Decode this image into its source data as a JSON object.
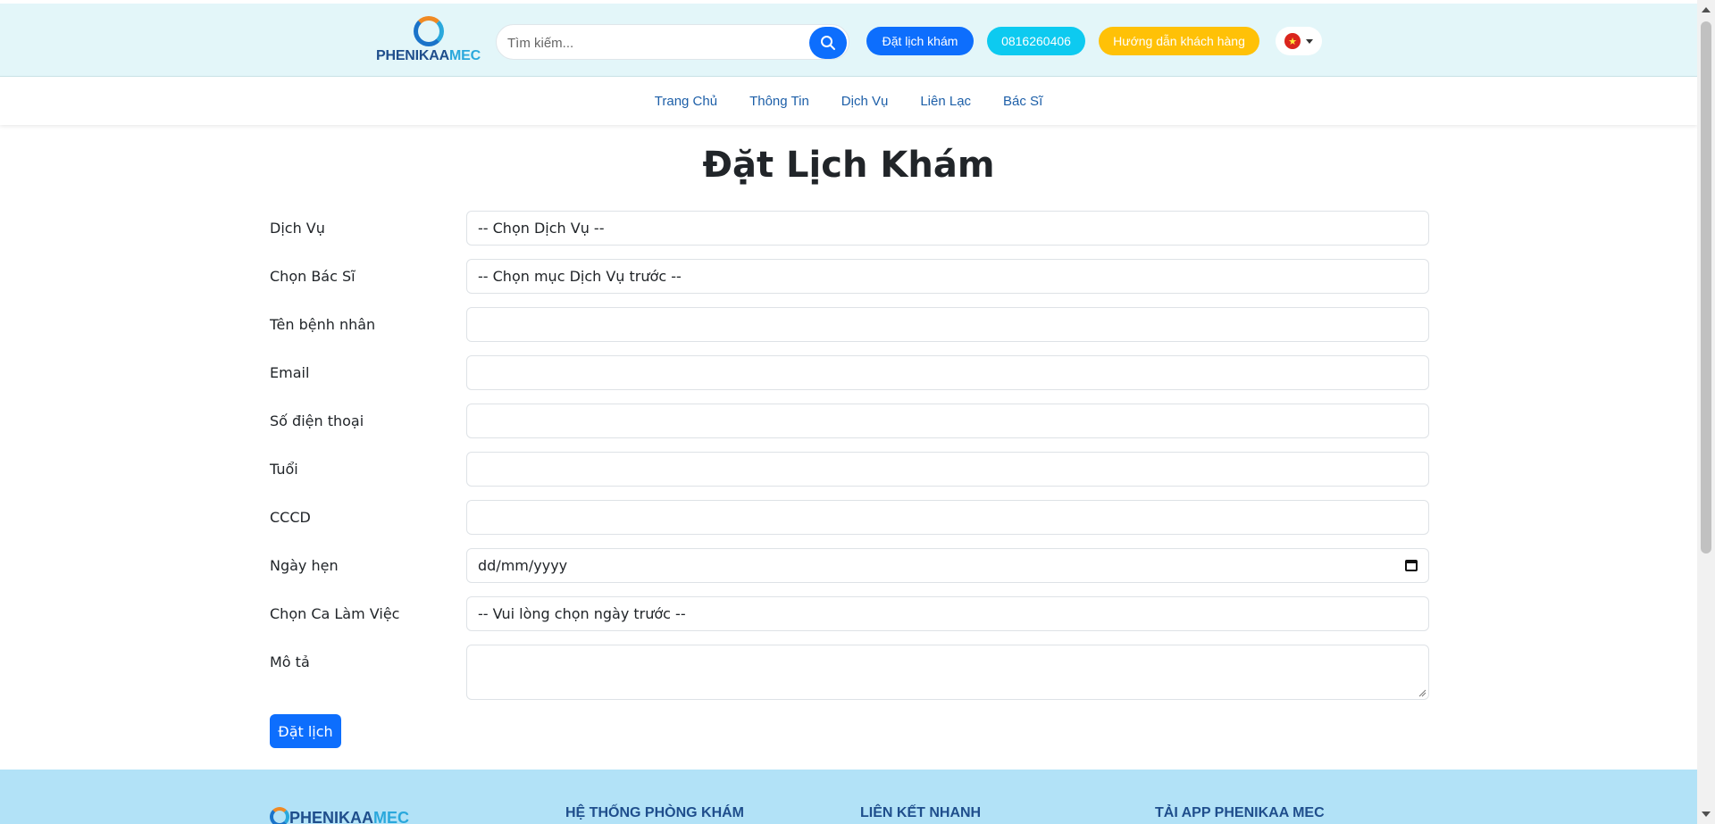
{
  "header": {
    "logo": {
      "part1": "PHENIKAA",
      "part2": "MEC"
    },
    "search": {
      "placeholder": "Tìm kiếm..."
    },
    "book_button": "Đặt lịch khám",
    "phone_button": "0816260406",
    "guide_button": "Hướng dẫn khách hàng",
    "language": {
      "icon": "vietnam-flag-icon"
    }
  },
  "nav": {
    "items": [
      "Trang Chủ",
      "Thông Tin",
      "Dịch Vụ",
      "Liên Lạc",
      "Bác Sĩ"
    ]
  },
  "main": {
    "title": "Đặt Lịch Khám",
    "fields": {
      "service": {
        "label": "Dịch Vụ",
        "value": "-- Chọn Dịch Vụ --"
      },
      "doctor": {
        "label": "Chọn Bác Sĩ",
        "value": "-- Chọn mục Dịch Vụ trước --"
      },
      "patient_name": {
        "label": "Tên bệnh nhân",
        "value": ""
      },
      "email": {
        "label": "Email",
        "value": ""
      },
      "phone": {
        "label": "Số điện thoại",
        "value": ""
      },
      "age": {
        "label": "Tuổi",
        "value": ""
      },
      "cccd": {
        "label": "CCCD",
        "value": ""
      },
      "date": {
        "label": "Ngày hẹn",
        "value": "dd/mm/yyyy"
      },
      "shift": {
        "label": "Chọn Ca Làm Việc",
        "value": "-- Vui lòng chọn ngày trước --"
      },
      "description": {
        "label": "Mô tả",
        "value": ""
      }
    },
    "submit_label": "Đặt lịch"
  },
  "footer": {
    "logo": {
      "part1": "PHENIKAA",
      "part2": "MEC"
    },
    "headings": [
      "HỆ THỐNG PHÒNG KHÁM",
      "LIÊN KẾT NHANH",
      "TẢI APP PHENIKAA MEC"
    ]
  },
  "colors": {
    "primary": "#0d6efd",
    "info": "#0dcaf0",
    "warning": "#ffc107",
    "header_bg": "#e3f6f9",
    "footer_bg": "#b2e2f7",
    "nav_link": "#1d5fa8"
  }
}
